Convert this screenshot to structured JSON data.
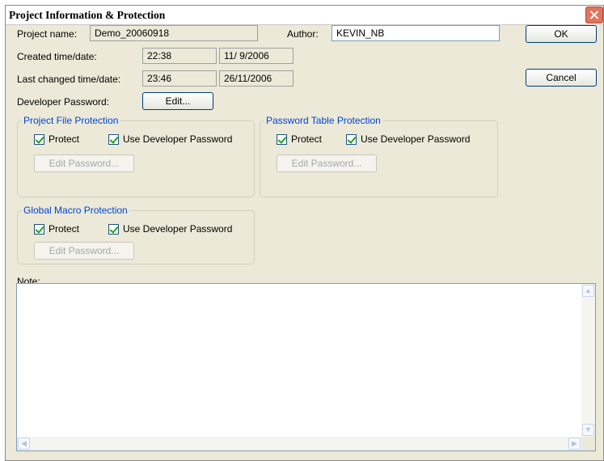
{
  "window": {
    "title": "Project Information & Protection"
  },
  "project": {
    "name_label": "Project name:",
    "name_value": "Demo_20060918",
    "author_label": "Author:",
    "author_value": "KEVIN_NB",
    "created_label": "Created time/date:",
    "created_time": "22:38",
    "created_date": "11/ 9/2006",
    "changed_label": "Last changed time/date:",
    "changed_time": "23:46",
    "changed_date": "26/11/2006",
    "dev_password_label": "Developer Password:",
    "edit_button": "Edit..."
  },
  "buttons": {
    "ok": "OK",
    "cancel": "Cancel"
  },
  "groups": {
    "project_file": {
      "title": "Project File Protection",
      "protect": "Protect",
      "use_dev": "Use Developer Password",
      "edit_password": "Edit Password..."
    },
    "password_table": {
      "title": "Password Table Protection",
      "protect": "Protect",
      "use_dev": "Use Developer Password",
      "edit_password": "Edit Password..."
    },
    "global_macro": {
      "title": "Global Macro Protection",
      "protect": "Protect",
      "use_dev": "Use Developer Password",
      "edit_password": "Edit Password..."
    }
  },
  "note": {
    "label": "Note:",
    "value": ""
  }
}
